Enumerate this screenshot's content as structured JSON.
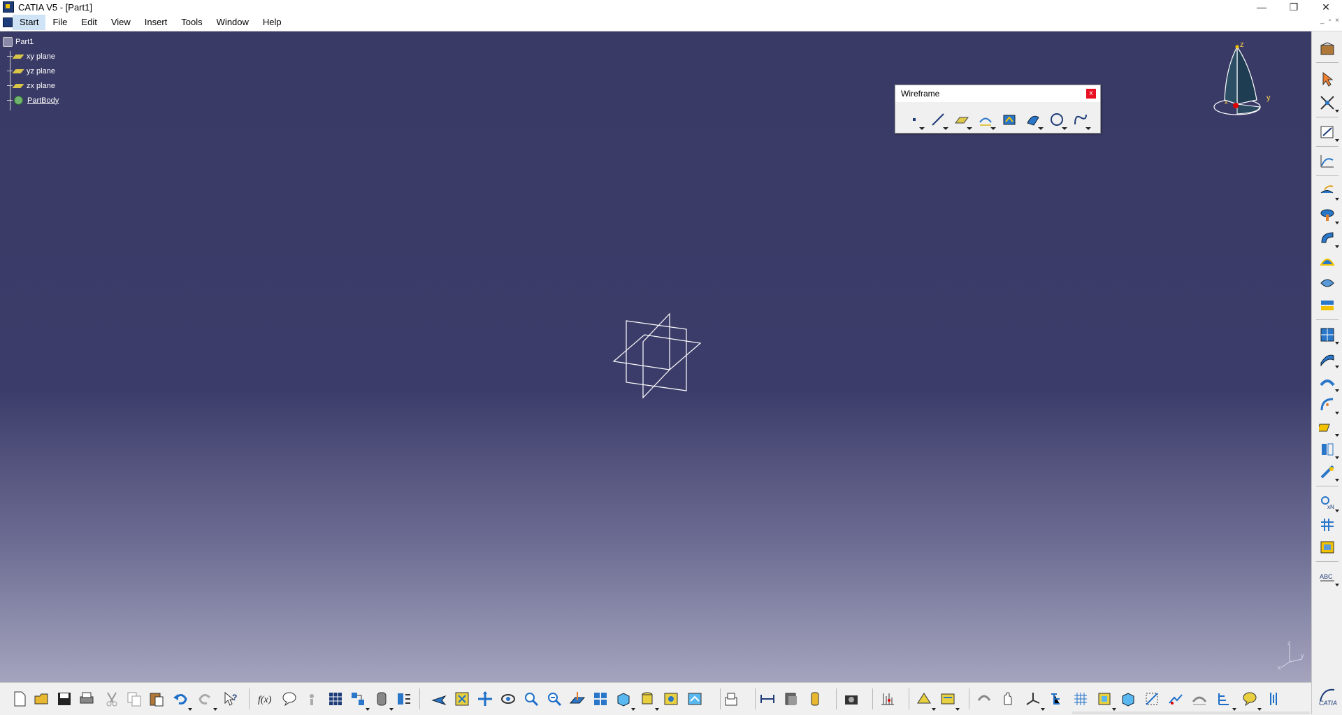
{
  "window": {
    "title": "CATIA V5 - [Part1]",
    "minimize_glyph": "—",
    "restore_glyph": "❐",
    "close_glyph": "✕"
  },
  "menu": {
    "items": [
      "Start",
      "File",
      "Edit",
      "View",
      "Insert",
      "Tools",
      "Window",
      "Help"
    ],
    "active": "Start"
  },
  "tree": {
    "root": "Part1",
    "children": [
      "xy plane",
      "yz plane",
      "zx plane",
      "PartBody"
    ]
  },
  "wireframe_toolbar": {
    "title": "Wireframe",
    "close_glyph": "x",
    "icons": [
      "point-icon",
      "line-icon",
      "plane-icon",
      "projection-icon",
      "combine-icon",
      "reflect-line-icon",
      "circle-icon",
      "spline-icon"
    ]
  },
  "compass": {
    "x_label": "x",
    "y_label": "y",
    "z_label": "z"
  },
  "triad": {
    "x_label": "x",
    "y_label": "y",
    "z_label": "z"
  },
  "right_toolbar": {
    "icons": [
      "workbench-icon",
      "select-icon",
      "snap-icon",
      "sketcher-icon",
      "positioned-sketch-icon",
      "extrude-surface-icon",
      "revolve-surface-icon",
      "sweep-icon",
      "fill-icon",
      "loft-icon",
      "blend-icon",
      "join-icon",
      "split-icon",
      "trim-icon",
      "fillet-icon",
      "translate-icon",
      "extrapolate-icon",
      "axis-system-icon",
      "repetition-icon",
      "grid-icon",
      "annotation-icon",
      "text-abc-icon"
    ],
    "abc_label": "ABC"
  },
  "bottom_toolbar": {
    "icons": [
      "new-icon",
      "open-icon",
      "save-icon",
      "print-icon",
      "cut-icon",
      "copy-icon",
      "paste-icon",
      "undo-icon",
      "redo-icon",
      "whats-this-icon",
      "formula-icon",
      "comment-icon",
      "knowledge-icon",
      "table-icon",
      "law-icon",
      "catalog-icon",
      "measure-icon",
      "fly-mode-icon",
      "fit-all-icon",
      "pan-icon",
      "rotate-icon",
      "zoom-in-icon",
      "zoom-out-icon",
      "normal-view-icon",
      "multi-view-icon",
      "iso-view-icon",
      "shading-icon",
      "hide-show-icon",
      "swap-space-icon",
      "scan-icon",
      "dimension-icon",
      "material-icon",
      "apply-icon",
      "capture-icon",
      "grid-icon",
      "sketch-tools-icon",
      "analysis-icon",
      "update-icon",
      "touch-icon",
      "axis-icon",
      "tree-icon",
      "mesh-icon",
      "plane-3d-icon",
      "box-icon",
      "cut-section-icon",
      "arrows-icon",
      "measure-between-icon",
      "parts-icon",
      "balloon-icon",
      "drawing-icon"
    ]
  }
}
